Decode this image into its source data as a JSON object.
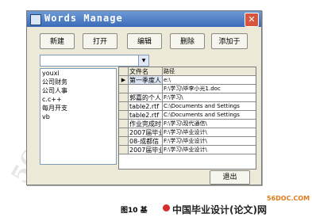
{
  "window": {
    "title": "Words Manage",
    "close_glyph": "✕"
  },
  "toolbar": {
    "new": "新建",
    "open": "打开",
    "edit": "编辑",
    "delete": "删除",
    "add_to": "添加于"
  },
  "combo": {
    "value": "",
    "arrow": "▼"
  },
  "list": {
    "items": [
      "youxi",
      "公司财务",
      "公司人事",
      "c.c++",
      "每月开支",
      "vb"
    ]
  },
  "grid": {
    "headers": [
      "文件名",
      "路径"
    ],
    "current_row_marker": "▶",
    "rows": [
      [
        "第一季度人",
        "e:\\"
      ],
      [
        "",
        "F:\\学习\\毕李小光1.doc"
      ],
      [
        "郭嘉的个人",
        "F:\\学习\\"
      ],
      [
        "table2.rtf",
        "C:\\Documents and Settings"
      ],
      [
        "table2.rtf",
        "C:\\Documents and Settings"
      ],
      [
        "作业完成时",
        "F:\\学习\\现代通信\\"
      ],
      [
        "2007届毕业",
        "F:\\学习\\毕业设计\\"
      ],
      [
        "08-成都信",
        "F:\\学习\\毕业设计\\"
      ],
      [
        "2007届毕业",
        "F:\\学习\\毕业设计\\"
      ]
    ]
  },
  "exit": "退出",
  "caption": "图10 基",
  "brand": "中国毕业设计(论文)网",
  "site": "56DOC.COM",
  "watermark": "56DOC.COM"
}
